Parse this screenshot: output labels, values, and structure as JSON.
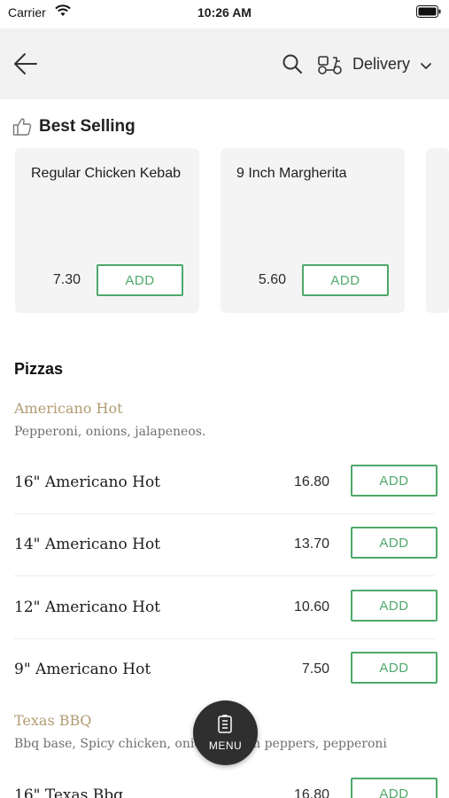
{
  "status_bar": {
    "carrier": "Carrier",
    "time": "10:26 AM"
  },
  "header": {
    "delivery_label": "Delivery",
    "icons": [
      "back-arrow-icon",
      "search-icon",
      "scooter-icon",
      "chevron-down-icon"
    ]
  },
  "best_selling": {
    "title": "Best Selling",
    "items": [
      {
        "name": "Regular Chicken Kebab",
        "price": "7.30",
        "add_label": "ADD"
      },
      {
        "name": "9 Inch Margherita",
        "price": "5.60",
        "add_label": "ADD"
      }
    ]
  },
  "menu": {
    "section_title": "Pizzas",
    "groups": [
      {
        "title": "Americano Hot",
        "description": "Pepperoni, onions, jalapeneos.",
        "items": [
          {
            "name": "16\" Americano Hot",
            "price": "16.80",
            "add_label": "ADD"
          },
          {
            "name": "14\" Americano Hot",
            "price": "13.70",
            "add_label": "ADD"
          },
          {
            "name": "12\" Americano Hot",
            "price": "10.60",
            "add_label": "ADD"
          },
          {
            "name": "9\" Americano Hot",
            "price": "7.50",
            "add_label": "ADD"
          }
        ]
      },
      {
        "title": "Texas BBQ",
        "description": "Bbq base, Spicy chicken, onions, green peppers, pepperoni",
        "items": [
          {
            "name": "16\" Texas Bbq",
            "price": "16.80",
            "add_label": "ADD"
          }
        ]
      }
    ]
  },
  "fab": {
    "label": "MENU"
  },
  "colors": {
    "accent": "#4ea86a",
    "group_title": "#b29b74",
    "header_bg": "#f2f2f2",
    "card_bg": "#f4f4f4",
    "fab_bg": "#2f2f2f"
  }
}
